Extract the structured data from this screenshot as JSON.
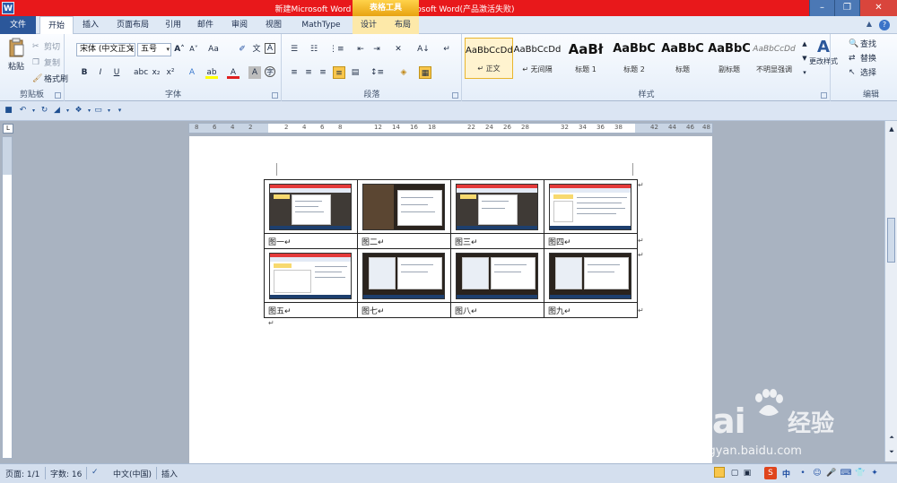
{
  "window": {
    "title": "新建Microsoft Word 文档.docx - Microsoft Word(产品激活失败)",
    "contextual_tab_title": "表格工具",
    "controls": [
      "minimize",
      "maximize",
      "close"
    ]
  },
  "tabs": {
    "file": "文件",
    "home": "开始",
    "insert": "插入",
    "page_layout": "页面布局",
    "references": "引用",
    "mailings": "邮件",
    "review": "审阅",
    "view": "视图",
    "mathtype": "MathType",
    "design": "设计",
    "layout": "布局"
  },
  "ribbon": {
    "clipboard": {
      "label": "剪贴板",
      "paste": "粘贴",
      "cut": "剪切",
      "copy": "复制",
      "format_painter": "格式刷"
    },
    "font": {
      "label": "字体",
      "font_name": "宋体 (中文正文",
      "font_size": "五号"
    },
    "paragraph": {
      "label": "段落"
    },
    "styles": {
      "label": "样式",
      "items": [
        {
          "sample": "AaBbCcDd",
          "name": "↵ 正文"
        },
        {
          "sample": "AaBbCcDd",
          "name": "↵ 无间隔"
        },
        {
          "sample": "AaBł",
          "name": "标题 1"
        },
        {
          "sample": "AaBbC",
          "name": "标题 2"
        },
        {
          "sample": "AaBbC",
          "name": "标题"
        },
        {
          "sample": "AaBbC",
          "name": "副标题"
        },
        {
          "sample": "AaBbCcDd",
          "name": "不明显强调"
        }
      ],
      "change_styles": "更改样式"
    },
    "editing": {
      "label": "编辑",
      "find": "查找",
      "replace": "替换",
      "select": "选择"
    }
  },
  "ruler": {
    "numbers": [
      "8",
      "6",
      "4",
      "2",
      "2",
      "4",
      "6",
      "8",
      "12",
      "14",
      "16",
      "18",
      "22",
      "24",
      "26",
      "28",
      "32",
      "34",
      "36",
      "38",
      "42",
      "44",
      "46",
      "48"
    ]
  },
  "document": {
    "captions": [
      [
        "图一↵",
        "图二↵",
        "图三↵",
        "图四↵"
      ],
      [
        "图五↵",
        "图七↵",
        "图八↵",
        "图九↵"
      ]
    ],
    "paragraph_mark": "↵"
  },
  "status": {
    "page": "页面: 1/1",
    "words": "字数: 16",
    "language": "中文(中国)",
    "mode": "插入",
    "ime_lang": "中"
  },
  "watermark": {
    "brand": "Bai",
    "brand2": "经验",
    "url": "jingyan.baidu.com"
  },
  "colors": {
    "title_bar": "#e8181b",
    "contextual_tab": "#f0b323",
    "file_tab": "#2b579a",
    "ribbon_bg": "#e5eef9"
  }
}
